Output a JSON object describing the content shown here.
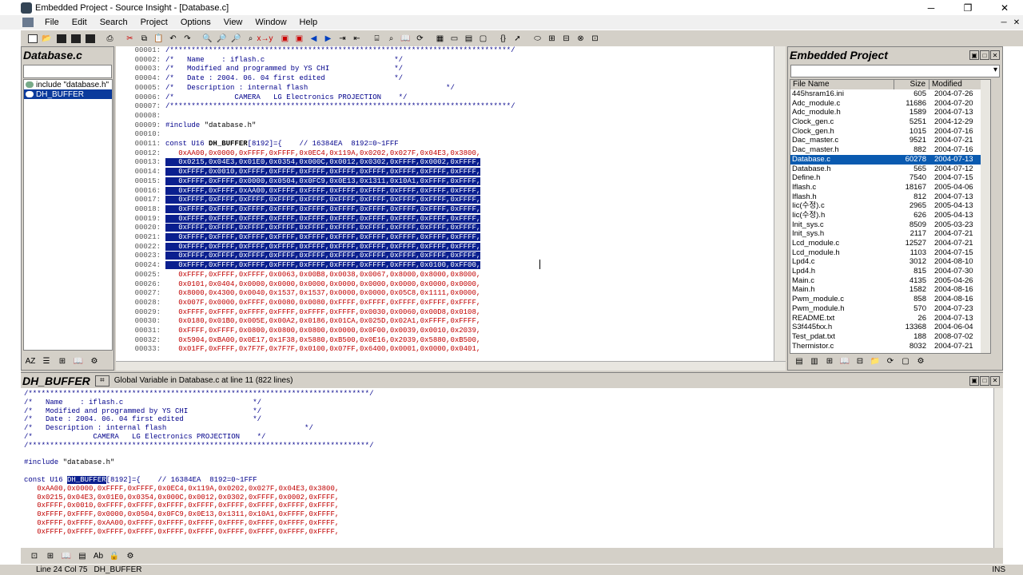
{
  "window": {
    "title": "Embedded Project - Source Insight - [Database.c]"
  },
  "menu": [
    "File",
    "Edit",
    "Search",
    "Project",
    "Options",
    "View",
    "Window",
    "Help"
  ],
  "left_pane": {
    "title": "Database.c",
    "symbols": [
      {
        "label": "include \"database.h\"",
        "selected": false
      },
      {
        "label": "DH_BUFFER",
        "selected": true
      }
    ]
  },
  "editor": {
    "header_lines": [
      {
        "n": "00001:",
        "text": "/*******************************************************************************/"
      },
      {
        "n": "00002:",
        "text": "/*   Name    : iflash.c                              */"
      },
      {
        "n": "00003:",
        "text": "/*   Modified and programmed by YS CHI               */"
      },
      {
        "n": "00004:",
        "text": "/*   Date : 2004. 06. 04 first edited                */"
      },
      {
        "n": "00005:",
        "text": "/*   Description : internal flash                                */"
      },
      {
        "n": "00006:",
        "text": "/*              CAMERA   LG Electronics PROJECTION    */"
      },
      {
        "n": "00007:",
        "text": "/*******************************************************************************/"
      },
      {
        "n": "00008:",
        "text": ""
      }
    ],
    "include_line": {
      "n": "00009:",
      "directive": "#include",
      "file": "\"database.h\""
    },
    "blank_line": {
      "n": "00010:"
    },
    "decl_line": {
      "n": "00011:",
      "kw": "const U16 ",
      "sym": "DH_BUFFER",
      "rest": "[8192]={",
      "comment": "    // 16384EA  8192=0~1FFF"
    },
    "data_lines": [
      {
        "n": "00012:",
        "text": "   0xAA00,0x0000,0xFFFF,0xFFFF,0x0EC4,0x119A,0x0202,0x027F,0x04E3,0x3800,",
        "hl": false
      },
      {
        "n": "00013:",
        "text": "   0x0215,0x04E3,0x01E0,0x0354,0x000C,0x0012,0x0302,0xFFFF,0x0002,0xFFFF,",
        "hl": true
      },
      {
        "n": "00014:",
        "text": "   0xFFFF,0x0010,0xFFFF,0xFFFF,0xFFFF,0xFFFF,0xFFFF,0xFFFF,0xFFFF,0xFFFF,",
        "hl": true
      },
      {
        "n": "00015:",
        "text": "   0xFFFF,0xFFFF,0x0000,0x0504,0x0FC9,0x0E13,0x1311,0x10A1,0xFFFF,0xFFFF,",
        "hl": true
      },
      {
        "n": "00016:",
        "text": "   0xFFFF,0xFFFF,0xAA00,0xFFFF,0xFFFF,0xFFFF,0xFFFF,0xFFFF,0xFFFF,0xFFFF,",
        "hl": true
      },
      {
        "n": "00017:",
        "text": "   0xFFFF,0xFFFF,0xFFFF,0xFFFF,0xFFFF,0xFFFF,0xFFFF,0xFFFF,0xFFFF,0xFFFF,",
        "hl": true
      },
      {
        "n": "00018:",
        "text": "   0xFFFF,0xFFFF,0xFFFF,0xFFFF,0xFFFF,0xFFFF,0xFFFF,0xFFFF,0xFFFF,0xFFFF,",
        "hl": true
      },
      {
        "n": "00019:",
        "text": "   0xFFFF,0xFFFF,0xFFFF,0xFFFF,0xFFFF,0xFFFF,0xFFFF,0xFFFF,0xFFFF,0xFFFF,",
        "hl": true
      },
      {
        "n": "00020:",
        "text": "   0xFFFF,0xFFFF,0xFFFF,0xFFFF,0xFFFF,0xFFFF,0xFFFF,0xFFFF,0xFFFF,0xFFFF,",
        "hl": true
      },
      {
        "n": "00021:",
        "text": "   0xFFFF,0xFFFF,0xFFFF,0xFFFF,0xFFFF,0xFFFF,0xFFFF,0xFFFF,0xFFFF,0xFFFF,",
        "hl": true
      },
      {
        "n": "00022:",
        "text": "   0xFFFF,0xFFFF,0xFFFF,0xFFFF,0xFFFF,0xFFFF,0xFFFF,0xFFFF,0xFFFF,0xFFFF,",
        "hl": true
      },
      {
        "n": "00023:",
        "text": "   0xFFFF,0xFFFF,0xFFFF,0xFFFF,0xFFFF,0xFFFF,0xFFFF,0xFFFF,0xFFFF,0xFFFF,",
        "hl": true
      },
      {
        "n": "00024:",
        "text": "   0xFFFF,0xFFFF,0xFFFF,0xFFFF,0xFFFF,0xFFFF,0xFFFF,0xFFFF,0x0100,0xFF00,",
        "hl": true
      },
      {
        "n": "00025:",
        "text": "   0xFFFF,0xFFFF,0xFFFF,0x0063,0x00B8,0x0038,0x0067,0x8000,0x8000,0x8000,",
        "hl": false
      },
      {
        "n": "00026:",
        "text": "   0x0101,0x0404,0x0000,0x0000,0x0000,0x0000,0x0000,0x0000,0x0000,0x0000,",
        "hl": false
      },
      {
        "n": "00027:",
        "text": "   0x8000,0x4300,0x0040,0x1537,0x1537,0x0000,0x0000,0x05C8,0x1111,0x0000,",
        "hl": false
      },
      {
        "n": "00028:",
        "text": "   0x007F,0x0000,0xFFFF,0x0080,0x0080,0xFFFF,0xFFFF,0xFFFF,0xFFFF,0xFFFF,",
        "hl": false
      },
      {
        "n": "00029:",
        "text": "   0xFFFF,0xFFFF,0xFFFF,0xFFFF,0xFFFF,0xFFFF,0x0030,0x0060,0x00D8,0x0108,",
        "hl": false
      },
      {
        "n": "00030:",
        "text": "   0x0180,0x01B0,0x005E,0x00A2,0x0186,0x01CA,0x025D,0x02A1,0xFFFF,0xFFFF,",
        "hl": false
      },
      {
        "n": "00031:",
        "text": "   0xFFFF,0xFFFF,0x0800,0x0800,0x0800,0x0000,0x0F00,0x0039,0x0010,0x2039,",
        "hl": false
      },
      {
        "n": "00032:",
        "text": "   0x5904,0xBA00,0x0E17,0x1F38,0x5880,0xB500,0x0E16,0x2039,0x5880,0xB500,",
        "hl": false
      },
      {
        "n": "00033:",
        "text": "   0x01FF,0xFFFF,0x7F7F,0x7F7F,0x0100,0x07FF,0x6400,0x0001,0x0000,0x0401,",
        "hl": false
      }
    ]
  },
  "right_pane": {
    "title": "Embedded Project",
    "columns": [
      "File Name",
      "Size",
      "Modified"
    ],
    "files": [
      {
        "name": "445hsram16.ini",
        "size": "605",
        "date": "2004-07-26",
        "sel": false
      },
      {
        "name": "Adc_module.c",
        "size": "11686",
        "date": "2004-07-20",
        "sel": false
      },
      {
        "name": "Adc_module.h",
        "size": "1589",
        "date": "2004-07-13",
        "sel": false
      },
      {
        "name": "Clock_gen.c",
        "size": "5251",
        "date": "2004-12-29",
        "sel": false
      },
      {
        "name": "Clock_gen.h",
        "size": "1015",
        "date": "2004-07-16",
        "sel": false
      },
      {
        "name": "Dac_master.c",
        "size": "9521",
        "date": "2004-07-21",
        "sel": false
      },
      {
        "name": "Dac_master.h",
        "size": "882",
        "date": "2004-07-16",
        "sel": false
      },
      {
        "name": "Database.c",
        "size": "60278",
        "date": "2004-07-13",
        "sel": true
      },
      {
        "name": "Database.h",
        "size": "565",
        "date": "2004-07-12",
        "sel": false
      },
      {
        "name": "Define.h",
        "size": "7540",
        "date": "2004-07-15",
        "sel": false
      },
      {
        "name": "Iflash.c",
        "size": "18167",
        "date": "2005-04-06",
        "sel": false
      },
      {
        "name": "Iflash.h",
        "size": "812",
        "date": "2004-07-13",
        "sel": false
      },
      {
        "name": "Iic(수정).c",
        "size": "2965",
        "date": "2005-04-13",
        "sel": false
      },
      {
        "name": "Iic(수정).h",
        "size": "626",
        "date": "2005-04-13",
        "sel": false
      },
      {
        "name": "Init_sys.c",
        "size": "8509",
        "date": "2005-03-23",
        "sel": false
      },
      {
        "name": "Init_sys.h",
        "size": "2117",
        "date": "2004-07-21",
        "sel": false
      },
      {
        "name": "Lcd_module.c",
        "size": "12527",
        "date": "2004-07-21",
        "sel": false
      },
      {
        "name": "Lcd_module.h",
        "size": "1103",
        "date": "2004-07-15",
        "sel": false
      },
      {
        "name": "Lpd4.c",
        "size": "3012",
        "date": "2004-08-10",
        "sel": false
      },
      {
        "name": "Lpd4.h",
        "size": "815",
        "date": "2004-07-30",
        "sel": false
      },
      {
        "name": "Main.c",
        "size": "4135",
        "date": "2005-04-26",
        "sel": false
      },
      {
        "name": "Main.h",
        "size": "1582",
        "date": "2004-08-16",
        "sel": false
      },
      {
        "name": "Pwm_module.c",
        "size": "858",
        "date": "2004-08-16",
        "sel": false
      },
      {
        "name": "Pwm_module.h",
        "size": "570",
        "date": "2004-07-23",
        "sel": false
      },
      {
        "name": "README.txt",
        "size": "26",
        "date": "2004-07-13",
        "sel": false
      },
      {
        "name": "S3f445fxx.h",
        "size": "13368",
        "date": "2004-06-04",
        "sel": false
      },
      {
        "name": "Test_pdat.txt",
        "size": "188",
        "date": "2008-07-02",
        "sel": false
      },
      {
        "name": "Thermistor.c",
        "size": "8032",
        "date": "2004-07-21",
        "sel": false
      }
    ]
  },
  "context": {
    "symbol": "DH_BUFFER",
    "description": "Global Variable in Database.c at line 11 (822 lines)",
    "header_lines": [
      "/*******************************************************************************/",
      "/*   Name    : iflash.c                              */",
      "/*   Modified and programmed by YS CHI               */",
      "/*   Date : 2004. 06. 04 first edited                */",
      "/*   Description : internal flash                                */",
      "/*              CAMERA   LG Electronics PROJECTION    */",
      "/*******************************************************************************/",
      ""
    ],
    "include_directive": "#include",
    "include_file": "\"database.h\"",
    "decl_kw": "const U16 ",
    "decl_sym": "DH_BUFFER",
    "decl_rest": "[8192]={",
    "decl_comment": "    // 16384EA  8192=0~1FFF",
    "data_lines": [
      "   0xAA00,0x0000,0xFFFF,0xFFFF,0x0EC4,0x119A,0x0202,0x027F,0x04E3,0x3800,",
      "   0x0215,0x04E3,0x01E0,0x0354,0x000C,0x0012,0x0302,0xFFFF,0x0002,0xFFFF,",
      "   0xFFFF,0x0010,0xFFFF,0xFFFF,0xFFFF,0xFFFF,0xFFFF,0xFFFF,0xFFFF,0xFFFF,",
      "   0xFFFF,0xFFFF,0x0000,0x0504,0x0FC9,0x0E13,0x1311,0x10A1,0xFFFF,0xFFFF,",
      "   0xFFFF,0xFFFF,0xAA00,0xFFFF,0xFFFF,0xFFFF,0xFFFF,0xFFFF,0xFFFF,0xFFFF,",
      "   0xFFFF,0xFFFF,0xFFFF,0xFFFF,0xFFFF,0xFFFF,0xFFFF,0xFFFF,0xFFFF,0xFFFF,"
    ]
  },
  "status": {
    "position": "Line 24  Col 75",
    "symbol": "DH_BUFFER",
    "mode": "INS"
  }
}
